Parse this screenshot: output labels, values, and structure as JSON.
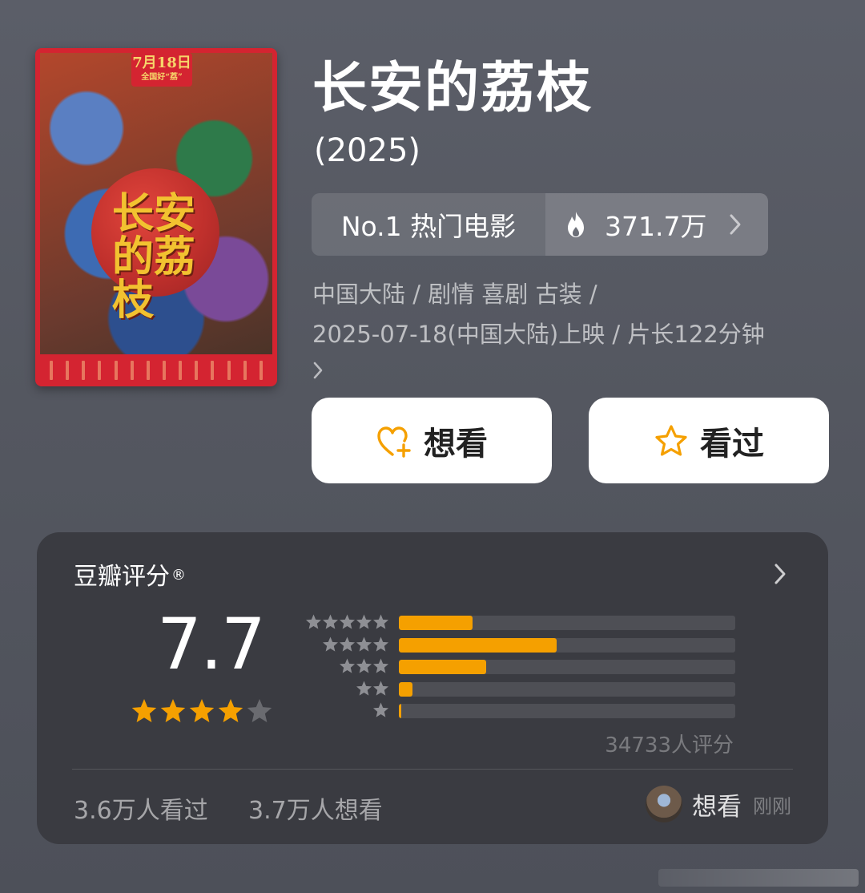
{
  "poster": {
    "title_art": "长安的荔枝",
    "date_badge": "7月18日",
    "date_badge_sub": "全国好“荔”"
  },
  "movie": {
    "title": "长安的荔枝",
    "year": "(2025)"
  },
  "rank": {
    "label": "No.1 热门电影",
    "heat": "371.7万",
    "icon": "flame-icon"
  },
  "meta": {
    "line1": "中国大陆 / 剧情 喜剧 古装 /",
    "line2": "2025-07-18(中国大陆)上映 / 片长122分钟"
  },
  "actions": {
    "want_label": "想看",
    "seen_label": "看过"
  },
  "rating": {
    "title": "豆瓣评分",
    "registered_mark": "®",
    "score": "7.7",
    "score_stars": 4,
    "distribution": [
      {
        "stars": 5,
        "fraction": 0.22
      },
      {
        "stars": 4,
        "fraction": 0.47
      },
      {
        "stars": 3,
        "fraction": 0.26
      },
      {
        "stars": 2,
        "fraction": 0.04
      },
      {
        "stars": 1,
        "fraction": 0.005
      }
    ],
    "count_label": "34733人评分",
    "seen_stat": "3.6万人看过",
    "want_stat": "3.7万人想看",
    "activity_label": "想看",
    "activity_time": "刚刚"
  },
  "colors": {
    "accent": "#f5a000",
    "star_gold": "#f5a000",
    "star_gray": "#6a6b70",
    "card_bg": "#3a3b41"
  }
}
